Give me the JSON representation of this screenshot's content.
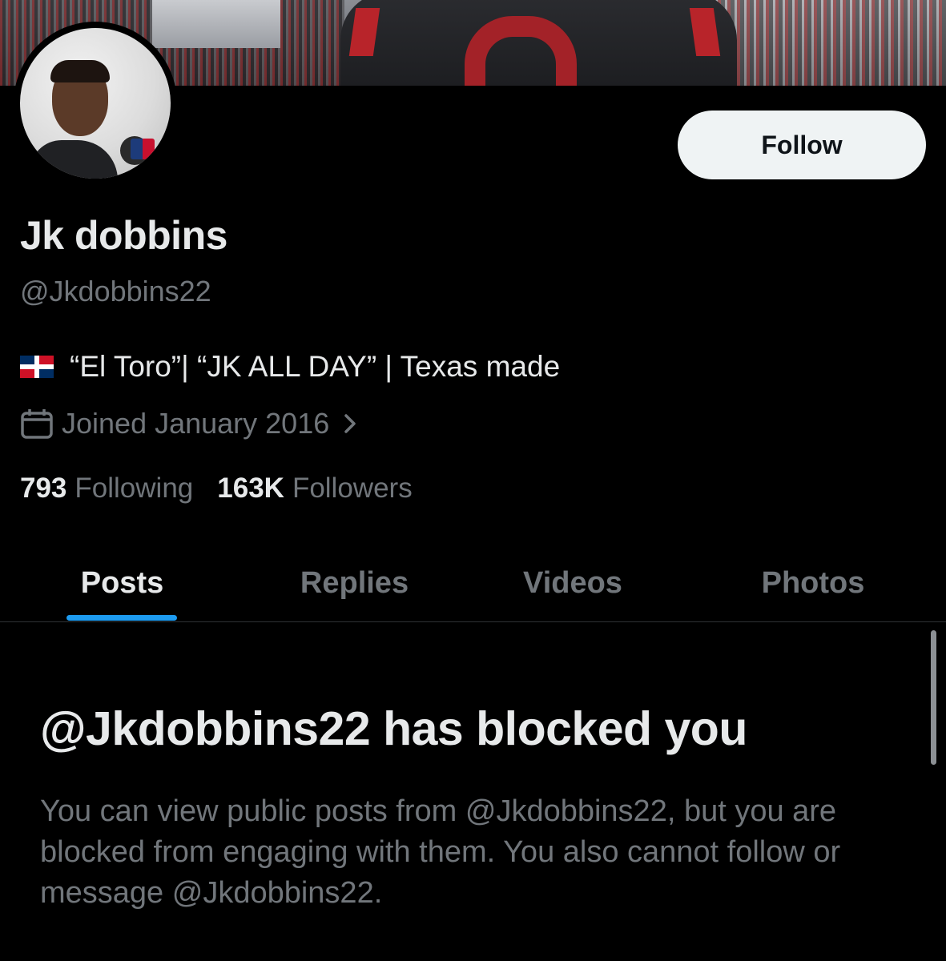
{
  "profile": {
    "display_name": "Jk dobbins",
    "handle": "@Jkdobbins22",
    "bio_flag_icon": "dominican-republic-flag-icon",
    "bio": "“El Toro”| “JK ALL DAY” | Texas made",
    "joined": "Joined January 2016",
    "following_count": "793",
    "following_label": "Following",
    "followers_count": "163K",
    "followers_label": "Followers"
  },
  "actions": {
    "follow_label": "Follow"
  },
  "tabs": [
    {
      "label": "Posts",
      "active": true
    },
    {
      "label": "Replies",
      "active": false
    },
    {
      "label": "Videos",
      "active": false
    },
    {
      "label": "Photos",
      "active": false
    }
  ],
  "blocked": {
    "title": "@Jkdobbins22 has blocked you",
    "message": "You can view public posts from @Jkdobbins22, but you are blocked from engaging with them. You also cannot follow or message @Jkdobbins22."
  },
  "colors": {
    "background": "#000000",
    "primary_text": "#e7e9ea",
    "secondary_text": "#71767b",
    "accent": "#1d9bf0",
    "follow_button_bg": "#eff3f4"
  }
}
